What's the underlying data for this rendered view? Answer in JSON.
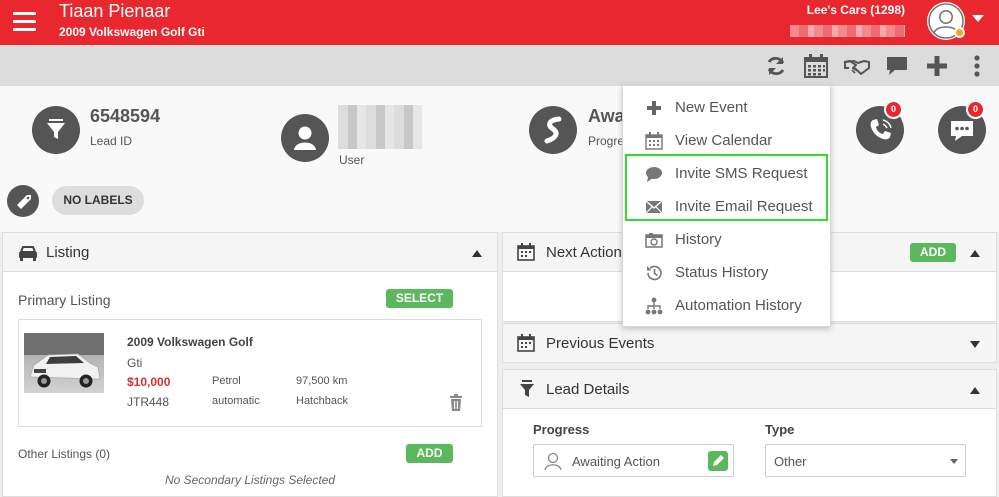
{
  "header": {
    "lead_name": "Tiaan Pienaar",
    "vehicle": "2009 Volkswagen Golf Gti",
    "dealer": "Lee's Cars (1298)"
  },
  "toolbar": {
    "icons": [
      "refresh-icon",
      "calendar-icon",
      "handshake-icon",
      "chat-icon",
      "plus-icon",
      "more-vertical-icon"
    ]
  },
  "summary": {
    "lead_id": "6548594",
    "lead_id_label": "Lead ID",
    "user_label": "User",
    "progress_value_partial": "Awa",
    "progress_label_partial": "Progre",
    "calls_badge": "0",
    "messages_badge": "0",
    "labels_button": "NO LABELS"
  },
  "listing": {
    "title": "Listing",
    "primary_label": "Primary Listing",
    "select_button": "SELECT",
    "car": {
      "name": "2009 Volkswagen Golf",
      "variant": "Gti",
      "price": "$10,000",
      "fuel": "Petrol",
      "mileage": "97,500 km",
      "reg": "JTR448",
      "transmission": "automatic",
      "body": "Hatchback"
    },
    "other_label": "Other Listings (0)",
    "add_button": "ADD",
    "empty_text": "No Secondary Listings Selected"
  },
  "next_action": {
    "title": "Next Action",
    "add_button": "ADD"
  },
  "previous_events": {
    "title": "Previous Events"
  },
  "lead_details": {
    "title": "Lead Details",
    "progress_label": "Progress",
    "progress_value": "Awaiting Action",
    "type_label": "Type",
    "type_value": "Other"
  },
  "dropdown": {
    "items": [
      {
        "label": "New Event",
        "icon": "plus-icon"
      },
      {
        "label": "View Calendar",
        "icon": "calendar-icon"
      },
      {
        "label": "Invite SMS Request",
        "icon": "chat-bubble-icon"
      },
      {
        "label": "Invite Email Request",
        "icon": "envelope-icon"
      },
      {
        "label": "History",
        "icon": "camera-icon"
      },
      {
        "label": "Status History",
        "icon": "history-icon"
      },
      {
        "label": "Automation History",
        "icon": "sitemap-icon"
      }
    ],
    "highlighted": [
      "Invite SMS Request",
      "Invite Email Request"
    ]
  },
  "colors": {
    "brand_red": "#e8272e",
    "toolbar_gray": "#dcdcdc",
    "button_green": "#5cb85c",
    "highlight_green": "#2fdc2f",
    "price_red": "#d32f2f"
  }
}
